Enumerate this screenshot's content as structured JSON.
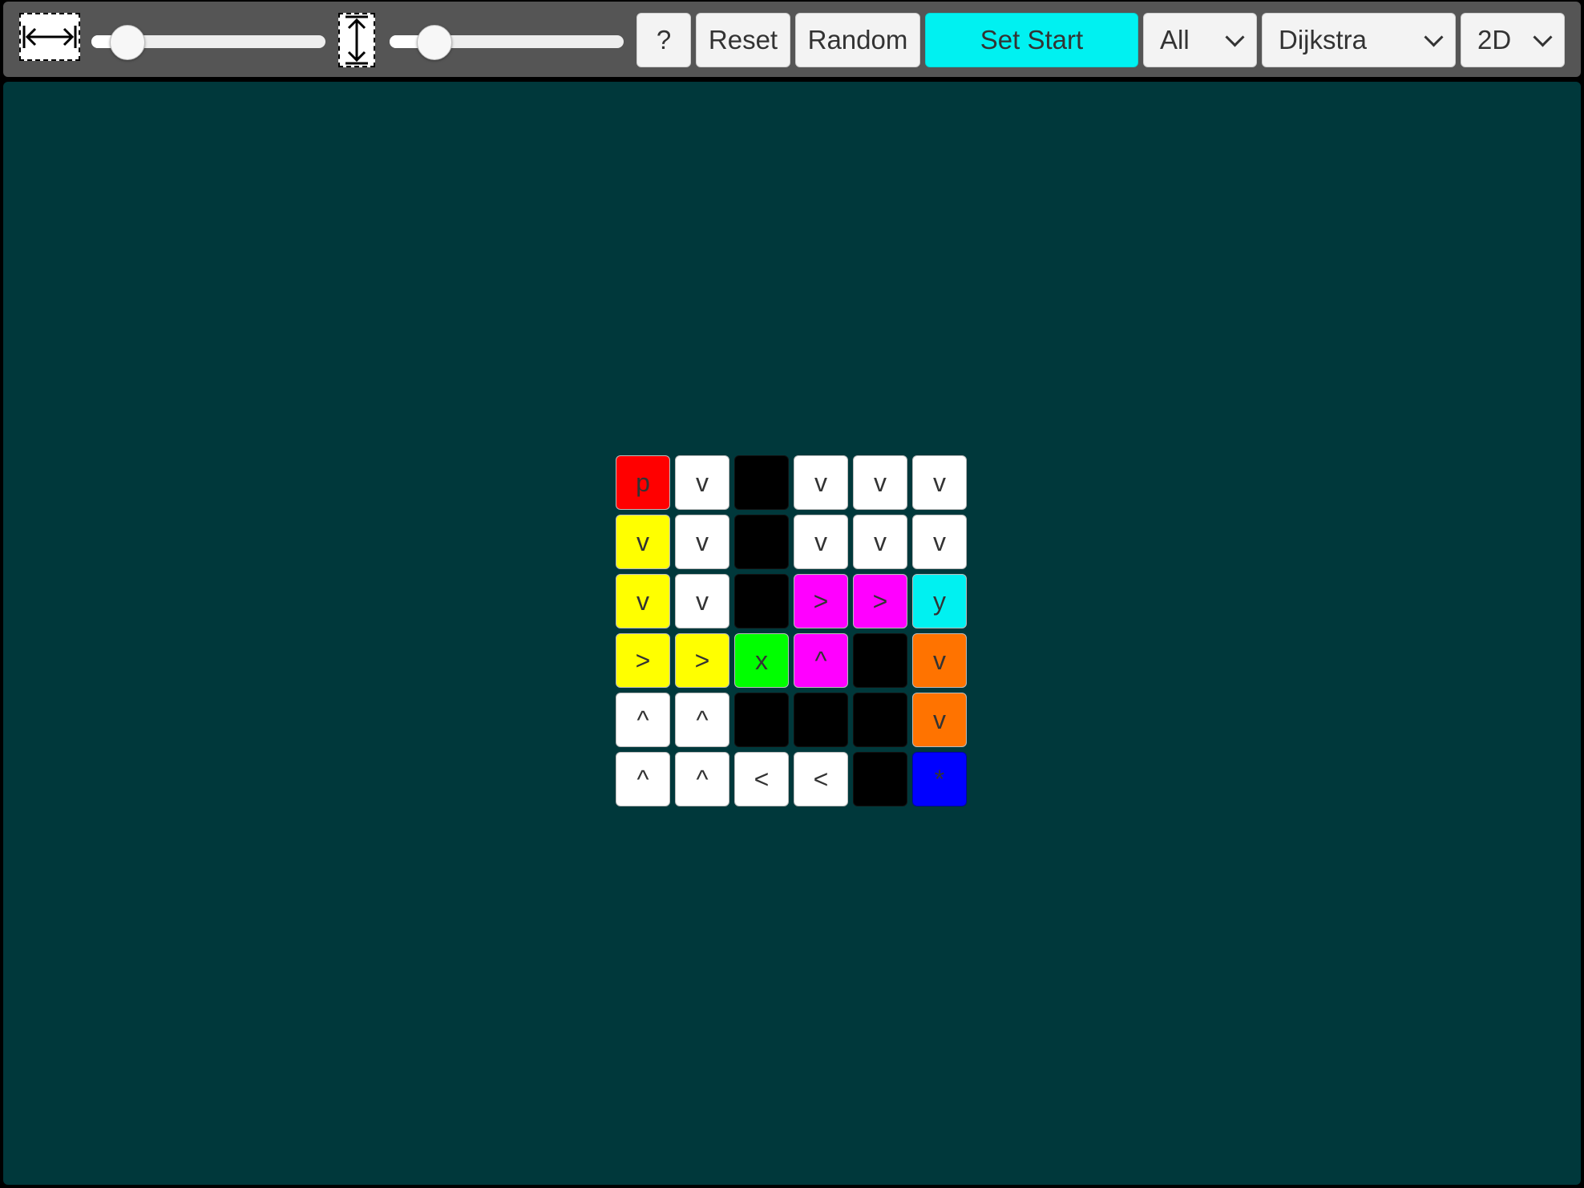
{
  "toolbar": {
    "width_icon": "horizontal-arrows-icon",
    "height_icon": "vertical-arrows-icon",
    "width_slider": {
      "value": 0.15
    },
    "height_slider": {
      "value": 0.19
    },
    "help_label": "?",
    "reset_label": "Reset",
    "random_label": "Random",
    "set_start_label": "Set Start",
    "filter_select": "All",
    "algorithm_select": "Dijkstra",
    "mode_select": "2D"
  },
  "colors": {
    "toolbar_bg": "#555555",
    "canvas_bg": "#00383b",
    "accent": "#00f1f1",
    "wall": "#000000",
    "empty": "#ffffff",
    "start": "#ff0000",
    "goal": "#0000ff",
    "path_yellow": "#ffff00",
    "path_magenta": "#ff00ff",
    "path_orange": "#ff7300",
    "marker_green": "#00ff00",
    "marker_cyan": "#00f1f1"
  },
  "grid": {
    "rows": [
      [
        {
          "t": "p",
          "c": "#ff0000"
        },
        {
          "t": "v",
          "c": "#ffffff"
        },
        {
          "t": "",
          "c": "#000000"
        },
        {
          "t": "v",
          "c": "#ffffff"
        },
        {
          "t": "v",
          "c": "#ffffff"
        },
        {
          "t": "v",
          "c": "#ffffff"
        }
      ],
      [
        {
          "t": "v",
          "c": "#ffff00"
        },
        {
          "t": "v",
          "c": "#ffffff"
        },
        {
          "t": "",
          "c": "#000000"
        },
        {
          "t": "v",
          "c": "#ffffff"
        },
        {
          "t": "v",
          "c": "#ffffff"
        },
        {
          "t": "v",
          "c": "#ffffff"
        }
      ],
      [
        {
          "t": "v",
          "c": "#ffff00"
        },
        {
          "t": "v",
          "c": "#ffffff"
        },
        {
          "t": "",
          "c": "#000000"
        },
        {
          "t": ">",
          "c": "#ff00ff"
        },
        {
          "t": ">",
          "c": "#ff00ff"
        },
        {
          "t": "y",
          "c": "#00f1f1"
        }
      ],
      [
        {
          "t": ">",
          "c": "#ffff00"
        },
        {
          "t": ">",
          "c": "#ffff00"
        },
        {
          "t": "x",
          "c": "#00ff00"
        },
        {
          "t": "^",
          "c": "#ff00ff"
        },
        {
          "t": "",
          "c": "#000000"
        },
        {
          "t": "v",
          "c": "#ff7300"
        }
      ],
      [
        {
          "t": "^",
          "c": "#ffffff"
        },
        {
          "t": "^",
          "c": "#ffffff"
        },
        {
          "t": "",
          "c": "#000000"
        },
        {
          "t": "",
          "c": "#000000"
        },
        {
          "t": "",
          "c": "#000000"
        },
        {
          "t": "v",
          "c": "#ff7300"
        }
      ],
      [
        {
          "t": "^",
          "c": "#ffffff"
        },
        {
          "t": "^",
          "c": "#ffffff"
        },
        {
          "t": "<",
          "c": "#ffffff"
        },
        {
          "t": "<",
          "c": "#ffffff"
        },
        {
          "t": "",
          "c": "#000000"
        },
        {
          "t": "*",
          "c": "#0000ff"
        }
      ]
    ]
  }
}
